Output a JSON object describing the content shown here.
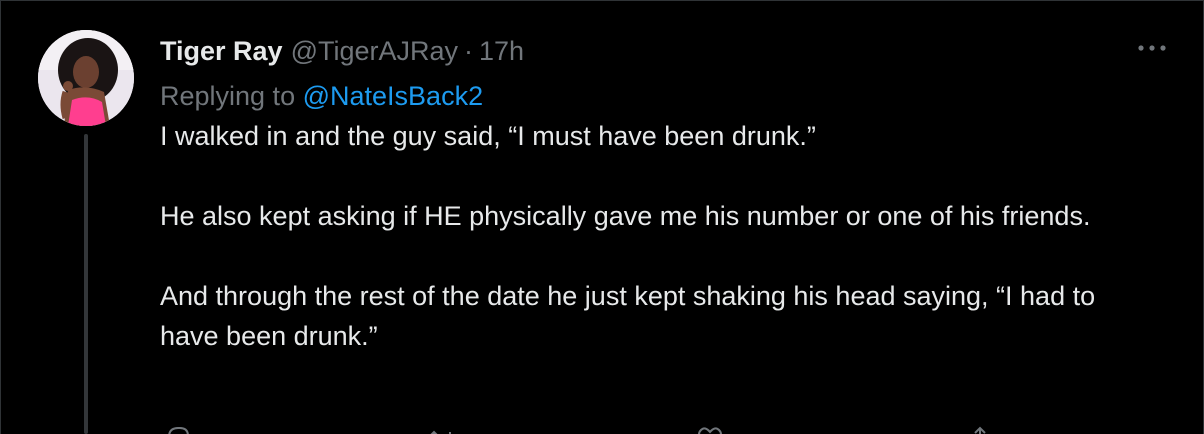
{
  "tweet": {
    "display_name": "Tiger Ray",
    "handle": "@TigerAJRay",
    "separator": "·",
    "time": "17h",
    "replying_prefix": "Replying to",
    "replying_to": "@NateIsBack2",
    "paragraphs": [
      "I walked in and the guy said, “I must have been drunk.”",
      "He also kept asking if HE physically gave me his number or one of his friends.",
      "And through the rest of the date he just kept shaking his head saying, “I had to have been drunk.”"
    ]
  },
  "icons": {
    "more": "more-horizontal-icon",
    "reply": "reply-icon",
    "retweet": "retweet-icon",
    "like": "heart-icon",
    "share": "share-icon"
  },
  "colors": {
    "background": "#000000",
    "primary_text": "#e7e9ea",
    "secondary_text": "#71767b",
    "link": "#1d9bf0",
    "border": "#2f3336"
  }
}
